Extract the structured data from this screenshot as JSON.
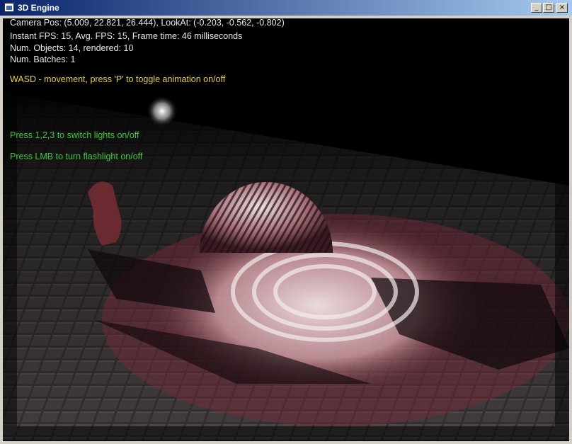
{
  "window": {
    "title": "3D Engine",
    "min_glyph": "_",
    "max_glyph": "□",
    "close_glyph": "×"
  },
  "hud": {
    "camera_line": "Camera Pos: (5.009, 22.821, 26.444), LookAt: (-0.203, -0.562, -0.802)",
    "fps_line": "Instant FPS: 15, Avg. FPS: 15, Frame time: 46 milliseconds",
    "objects_line": "Num. Objects: 14, rendered: 10",
    "batches_line": "Num. Batches: 1",
    "movement_hint": "WASD - movement, press 'P' to toggle animation on/off",
    "lights_hint": "Press 1,2,3 to switch lights on/off",
    "flashlight_hint": "Press LMB to turn flashlight on/off"
  },
  "colors": {
    "hud_text": "#e8e8e8",
    "hint_yellow": "#e6d24a",
    "hint_green": "#3ec83e",
    "titlebar_start": "#0a246a",
    "titlebar_end": "#a6caf0"
  }
}
